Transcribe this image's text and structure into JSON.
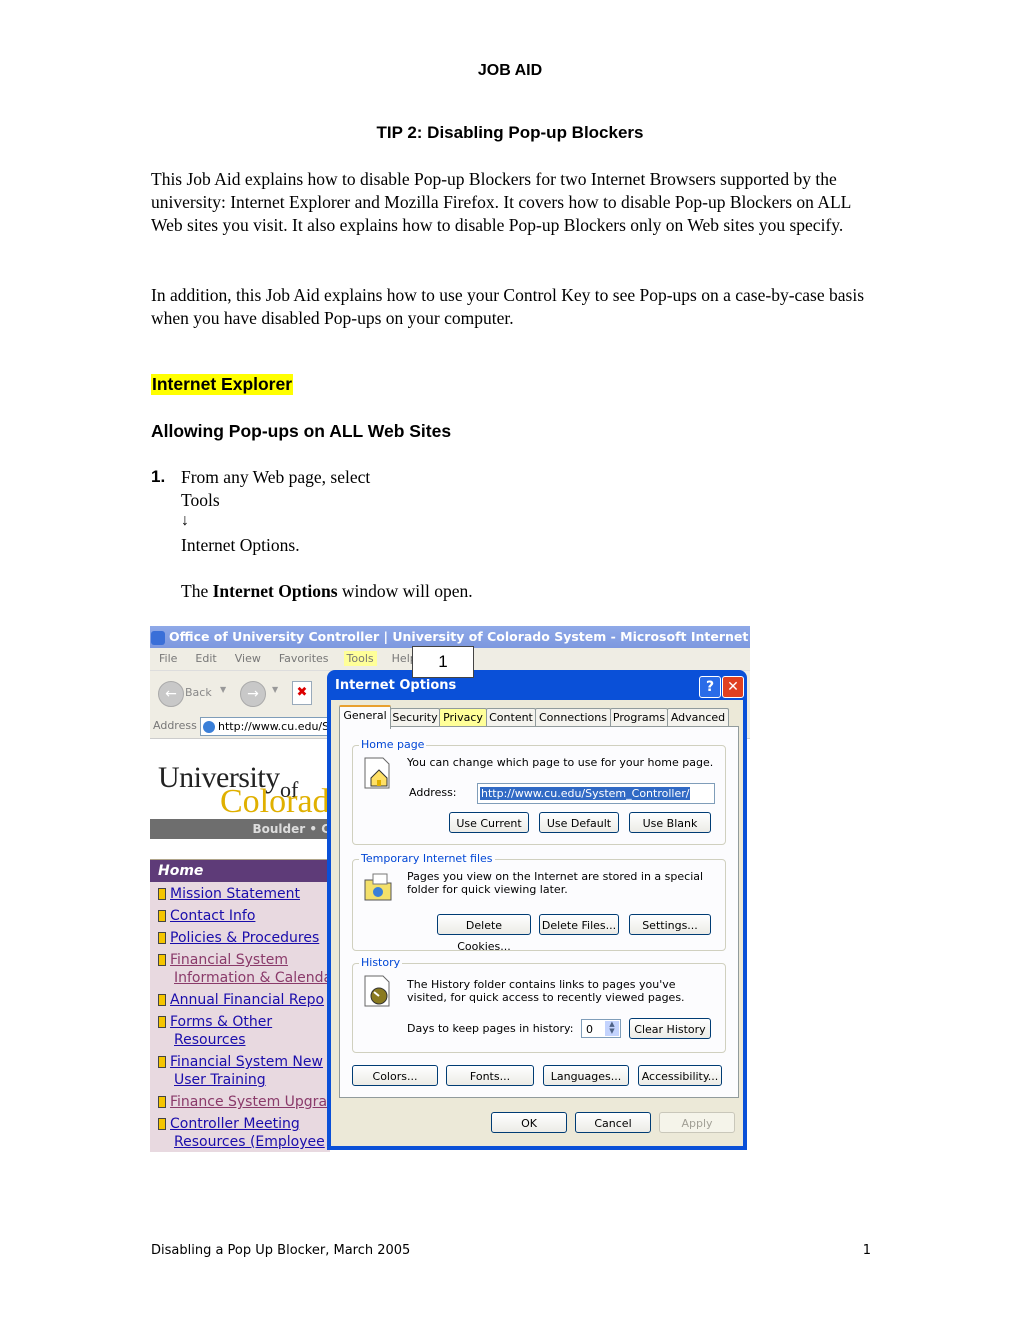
{
  "document": {
    "title": "JOB AID",
    "subtitle": "TIP 2:  Disabling Pop-up Blockers",
    "intro_paragraph": "This Job Aid explains how to disable Pop-up Blockers for two Internet Browsers supported by the university:  Internet Explorer and Mozilla Firefox.  It covers how to disable Pop-up Blockers on ALL Web sites you visit.  It also explains how to disable Pop-up Blockers only on Web sites you specify.",
    "second_paragraph": "In addition, this Job Aid explains how to use your Control Key to see Pop-ups on a case-by-case basis when you have disabled Pop-ups on your computer.",
    "section_heading": "Internet Explorer",
    "section_highlight_color": "#ffff00",
    "subsection_heading": "Allowing Pop-ups on ALL Web Sites",
    "step": {
      "number": "1.",
      "line1": "From any Web page, select",
      "line2": "Tools",
      "arrow_icon": "↓",
      "line3": "Internet Options.",
      "result_prefix": "The ",
      "result_bold": "Internet Options",
      "result_suffix": " window will open."
    },
    "footer": {
      "left": "Disabling a Pop Up Blocker,  March 2005",
      "page_number": "1"
    }
  },
  "screenshot": {
    "window_title": "Office of University Controller | University of Colorado System - Microsoft Internet Explorer",
    "menu": [
      "File",
      "Edit",
      "View",
      "Favorites",
      "Tools",
      "Help"
    ],
    "menu_highlighted": "Tools",
    "back_label": "Back",
    "address_label": "Address",
    "address_value": "http://www.cu.edu/System_Controller/",
    "callout_number": "1",
    "site": {
      "logo_line1": "University",
      "logo_of": "of",
      "logo_line2": "Colorado",
      "band_text": "Boulder • C",
      "nav_home": "Home",
      "nav_items": [
        {
          "line1": "Mission Statement",
          "line2": "",
          "visited": false
        },
        {
          "line1": "Contact Info",
          "line2": "",
          "visited": false
        },
        {
          "line1": "Policies & Procedures",
          "line2": "",
          "visited": false
        },
        {
          "line1": "Financial System",
          "line2": "Information & Calenda",
          "visited": true
        },
        {
          "line1": "Annual Financial Repo",
          "line2": "",
          "visited": false
        },
        {
          "line1": "Forms & Other",
          "line2": "Resources",
          "visited": false
        },
        {
          "line1": "Financial System New",
          "line2": "User Training",
          "visited": false
        },
        {
          "line1": "Finance System Upgra",
          "line2": "",
          "visited": true
        },
        {
          "line1": "Controller Meeting",
          "line2": "Resources (Employee",
          "visited": false
        }
      ]
    },
    "dialog": {
      "title": "Internet Options",
      "help_label": "?",
      "close_label": "✕",
      "tabs": [
        "General",
        "Security",
        "Privacy",
        "Content",
        "Connections",
        "Programs",
        "Advanced"
      ],
      "active_tab": "General",
      "highlighted_tab": "Privacy",
      "home_page": {
        "label": "Home page",
        "description": "You can change which page to use for your home page.",
        "address_label": "Address:",
        "address_value": "http://www.cu.edu/System_Controller/",
        "buttons": [
          "Use Current",
          "Use Default",
          "Use Blank"
        ]
      },
      "temp_files": {
        "label": "Temporary Internet files",
        "description": "Pages you view on the Internet are stored in a special folder for quick viewing later.",
        "buttons": [
          "Delete Cookies...",
          "Delete Files...",
          "Settings..."
        ]
      },
      "history": {
        "label": "History",
        "description": "The History folder contains links to pages you've visited, for quick access to recently viewed pages.",
        "days_label": "Days to keep pages in history:",
        "days_value": "0",
        "clear_button": "Clear History"
      },
      "bottom_buttons": [
        "Colors...",
        "Fonts...",
        "Languages...",
        "Accessibility..."
      ],
      "action_buttons": {
        "ok": "OK",
        "cancel": "Cancel",
        "apply": "Apply"
      }
    }
  }
}
